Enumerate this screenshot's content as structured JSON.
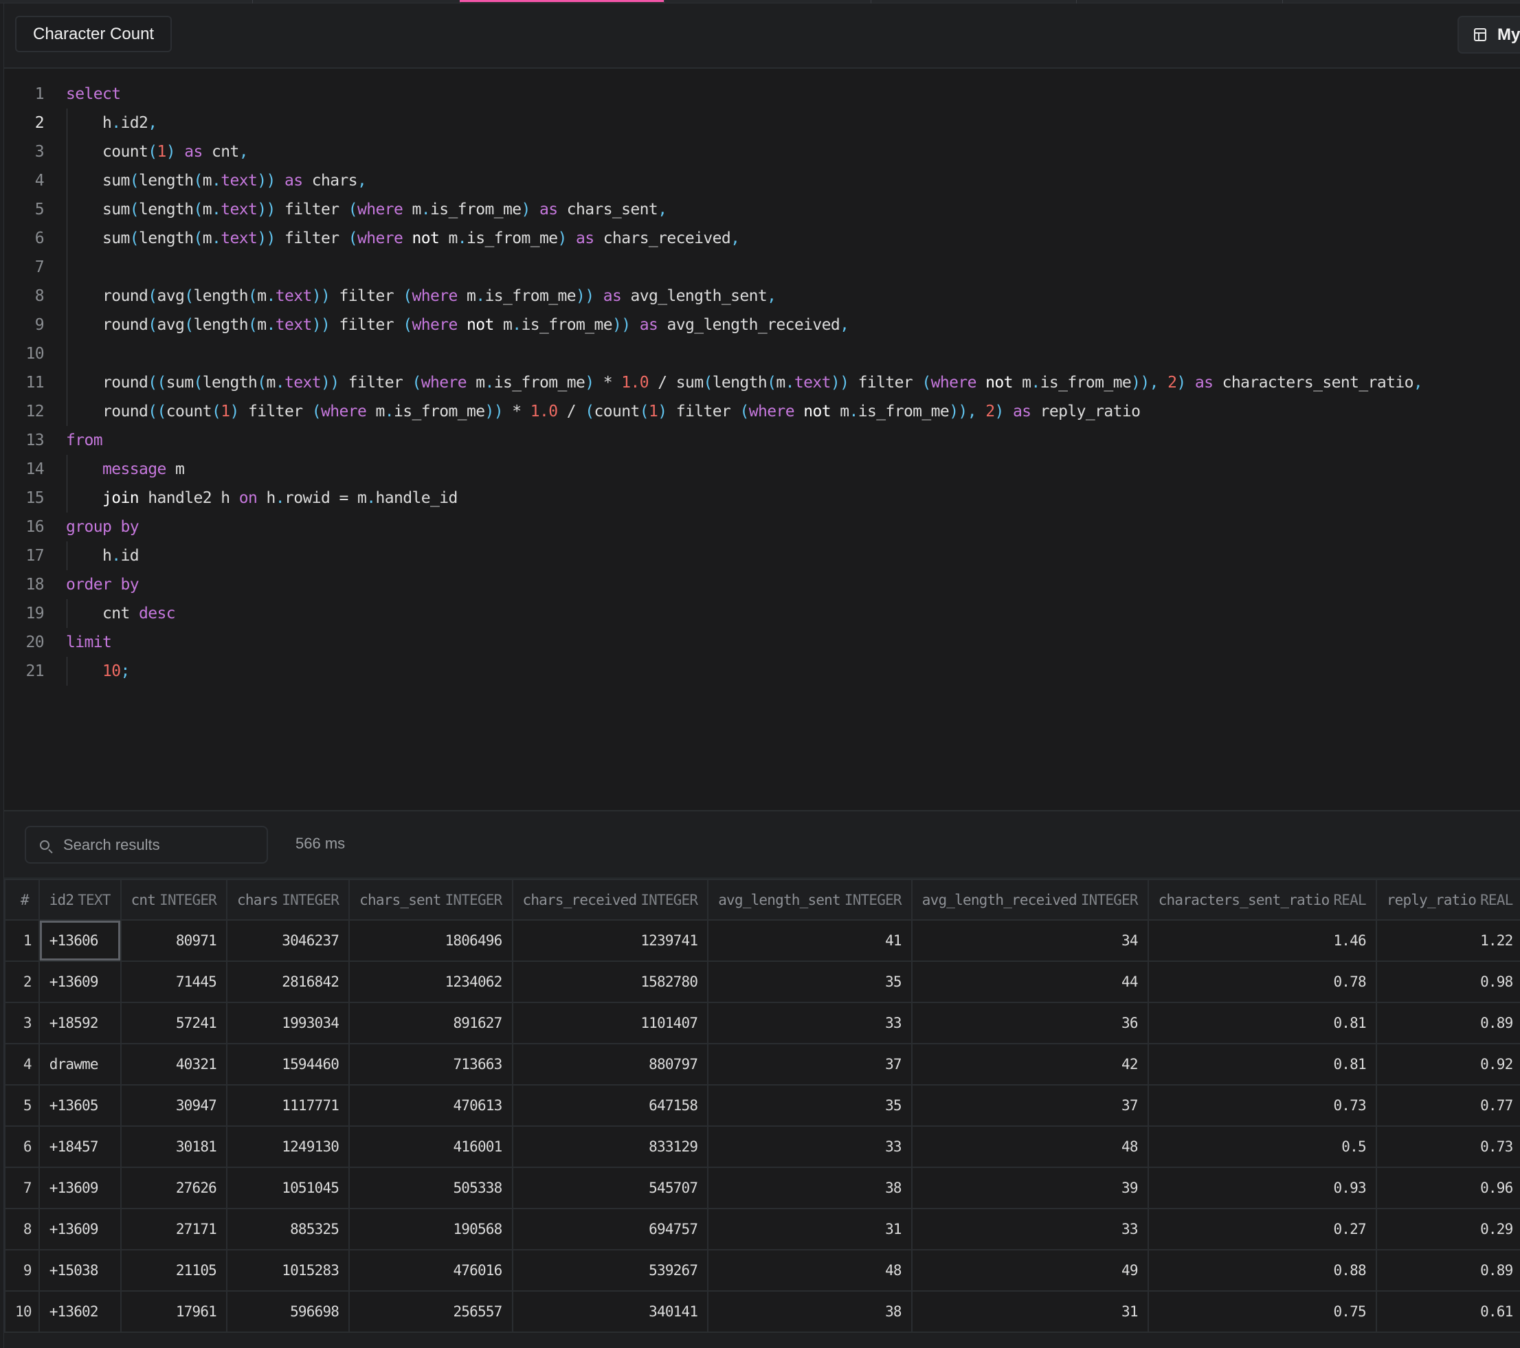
{
  "tabstrip": {
    "separators": 7,
    "active_color": "#f255a8"
  },
  "toolbar": {
    "title": "Character Count",
    "view_button_label": "My",
    "view_button_icon": "layout-icon"
  },
  "editor": {
    "active_line": 2,
    "lines": [
      {
        "num": "1",
        "indent": false,
        "tokens": [
          [
            "k",
            "select"
          ]
        ]
      },
      {
        "num": "2",
        "indent": true,
        "tokens": [
          [
            "t",
            "h"
          ],
          [
            "p",
            "."
          ],
          [
            "t",
            "id2"
          ],
          [
            "p",
            ","
          ]
        ]
      },
      {
        "num": "3",
        "indent": true,
        "tokens": [
          [
            "t",
            "count"
          ],
          [
            "p",
            "("
          ],
          [
            "n",
            "1"
          ],
          [
            "p",
            ")"
          ],
          [
            "t",
            " "
          ],
          [
            "k",
            "as"
          ],
          [
            "t",
            " cnt"
          ],
          [
            "p",
            ","
          ]
        ]
      },
      {
        "num": "4",
        "indent": true,
        "tokens": [
          [
            "t",
            "sum"
          ],
          [
            "p",
            "("
          ],
          [
            "t",
            "length"
          ],
          [
            "p",
            "("
          ],
          [
            "t",
            "m"
          ],
          [
            "p",
            "."
          ],
          [
            "k",
            "text"
          ],
          [
            "p",
            "))"
          ],
          [
            "t",
            " "
          ],
          [
            "k",
            "as"
          ],
          [
            "t",
            " chars"
          ],
          [
            "p",
            ","
          ]
        ]
      },
      {
        "num": "5",
        "indent": true,
        "tokens": [
          [
            "t",
            "sum"
          ],
          [
            "p",
            "("
          ],
          [
            "t",
            "length"
          ],
          [
            "p",
            "("
          ],
          [
            "t",
            "m"
          ],
          [
            "p",
            "."
          ],
          [
            "k",
            "text"
          ],
          [
            "p",
            "))"
          ],
          [
            "t",
            " filter "
          ],
          [
            "p",
            "("
          ],
          [
            "k",
            "where"
          ],
          [
            "t",
            " m"
          ],
          [
            "p",
            "."
          ],
          [
            "t",
            "is_from_me"
          ],
          [
            "p",
            ")"
          ],
          [
            "t",
            " "
          ],
          [
            "k",
            "as"
          ],
          [
            "t",
            " chars_sent"
          ],
          [
            "p",
            ","
          ]
        ]
      },
      {
        "num": "6",
        "indent": true,
        "tokens": [
          [
            "t",
            "sum"
          ],
          [
            "p",
            "("
          ],
          [
            "t",
            "length"
          ],
          [
            "p",
            "("
          ],
          [
            "t",
            "m"
          ],
          [
            "p",
            "."
          ],
          [
            "k",
            "text"
          ],
          [
            "p",
            "))"
          ],
          [
            "t",
            " filter "
          ],
          [
            "p",
            "("
          ],
          [
            "k",
            "where"
          ],
          [
            "w",
            " not"
          ],
          [
            "t",
            " m"
          ],
          [
            "p",
            "."
          ],
          [
            "t",
            "is_from_me"
          ],
          [
            "p",
            ")"
          ],
          [
            "t",
            " "
          ],
          [
            "k",
            "as"
          ],
          [
            "t",
            " chars_received"
          ],
          [
            "p",
            ","
          ]
        ]
      },
      {
        "num": "7",
        "indent": true,
        "tokens": []
      },
      {
        "num": "8",
        "indent": true,
        "tokens": [
          [
            "t",
            "round"
          ],
          [
            "p",
            "("
          ],
          [
            "t",
            "avg"
          ],
          [
            "p",
            "("
          ],
          [
            "t",
            "length"
          ],
          [
            "p",
            "("
          ],
          [
            "t",
            "m"
          ],
          [
            "p",
            "."
          ],
          [
            "k",
            "text"
          ],
          [
            "p",
            "))"
          ],
          [
            "t",
            " filter "
          ],
          [
            "p",
            "("
          ],
          [
            "k",
            "where"
          ],
          [
            "t",
            " m"
          ],
          [
            "p",
            "."
          ],
          [
            "t",
            "is_from_me"
          ],
          [
            "p",
            "))"
          ],
          [
            "t",
            " "
          ],
          [
            "k",
            "as"
          ],
          [
            "t",
            " avg_length_sent"
          ],
          [
            "p",
            ","
          ]
        ]
      },
      {
        "num": "9",
        "indent": true,
        "tokens": [
          [
            "t",
            "round"
          ],
          [
            "p",
            "("
          ],
          [
            "t",
            "avg"
          ],
          [
            "p",
            "("
          ],
          [
            "t",
            "length"
          ],
          [
            "p",
            "("
          ],
          [
            "t",
            "m"
          ],
          [
            "p",
            "."
          ],
          [
            "k",
            "text"
          ],
          [
            "p",
            "))"
          ],
          [
            "t",
            " filter "
          ],
          [
            "p",
            "("
          ],
          [
            "k",
            "where"
          ],
          [
            "w",
            " not"
          ],
          [
            "t",
            " m"
          ],
          [
            "p",
            "."
          ],
          [
            "t",
            "is_from_me"
          ],
          [
            "p",
            "))"
          ],
          [
            "t",
            " "
          ],
          [
            "k",
            "as"
          ],
          [
            "t",
            " avg_length_received"
          ],
          [
            "p",
            ","
          ]
        ]
      },
      {
        "num": "10",
        "indent": true,
        "tokens": []
      },
      {
        "num": "11",
        "indent": true,
        "tokens": [
          [
            "t",
            "round"
          ],
          [
            "p",
            "(("
          ],
          [
            "t",
            "sum"
          ],
          [
            "p",
            "("
          ],
          [
            "t",
            "length"
          ],
          [
            "p",
            "("
          ],
          [
            "t",
            "m"
          ],
          [
            "p",
            "."
          ],
          [
            "k",
            "text"
          ],
          [
            "p",
            "))"
          ],
          [
            "t",
            " filter "
          ],
          [
            "p",
            "("
          ],
          [
            "k",
            "where"
          ],
          [
            "t",
            " m"
          ],
          [
            "p",
            "."
          ],
          [
            "t",
            "is_from_me"
          ],
          [
            "p",
            ")"
          ],
          [
            "t",
            " * "
          ],
          [
            "n",
            "1.0"
          ],
          [
            "t",
            " / sum"
          ],
          [
            "p",
            "("
          ],
          [
            "t",
            "length"
          ],
          [
            "p",
            "("
          ],
          [
            "t",
            "m"
          ],
          [
            "p",
            "."
          ],
          [
            "k",
            "text"
          ],
          [
            "p",
            "))"
          ],
          [
            "t",
            " filter "
          ],
          [
            "p",
            "("
          ],
          [
            "k",
            "where"
          ],
          [
            "w",
            " not"
          ],
          [
            "t",
            " m"
          ],
          [
            "p",
            "."
          ],
          [
            "t",
            "is_from_me"
          ],
          [
            "p",
            "))"
          ],
          [
            "p",
            ","
          ],
          [
            "t",
            " "
          ],
          [
            "n",
            "2"
          ],
          [
            "p",
            ")"
          ],
          [
            "t",
            " "
          ],
          [
            "k",
            "as"
          ],
          [
            "t",
            " characters_sent_ratio"
          ],
          [
            "p",
            ","
          ]
        ]
      },
      {
        "num": "12",
        "indent": true,
        "tokens": [
          [
            "t",
            "round"
          ],
          [
            "p",
            "(("
          ],
          [
            "t",
            "count"
          ],
          [
            "p",
            "("
          ],
          [
            "n",
            "1"
          ],
          [
            "p",
            ")"
          ],
          [
            "t",
            " filter "
          ],
          [
            "p",
            "("
          ],
          [
            "k",
            "where"
          ],
          [
            "t",
            " m"
          ],
          [
            "p",
            "."
          ],
          [
            "t",
            "is_from_me"
          ],
          [
            "p",
            "))"
          ],
          [
            "t",
            " * "
          ],
          [
            "n",
            "1.0"
          ],
          [
            "t",
            " / "
          ],
          [
            "p",
            "("
          ],
          [
            "t",
            "count"
          ],
          [
            "p",
            "("
          ],
          [
            "n",
            "1"
          ],
          [
            "p",
            ")"
          ],
          [
            "t",
            " filter "
          ],
          [
            "p",
            "("
          ],
          [
            "k",
            "where"
          ],
          [
            "w",
            " not"
          ],
          [
            "t",
            " m"
          ],
          [
            "p",
            "."
          ],
          [
            "t",
            "is_from_me"
          ],
          [
            "p",
            "))"
          ],
          [
            "p",
            ","
          ],
          [
            "t",
            " "
          ],
          [
            "n",
            "2"
          ],
          [
            "p",
            ")"
          ],
          [
            "t",
            " "
          ],
          [
            "k",
            "as"
          ],
          [
            "t",
            " reply_ratio"
          ]
        ]
      },
      {
        "num": "13",
        "indent": false,
        "tokens": [
          [
            "k",
            "from"
          ]
        ]
      },
      {
        "num": "14",
        "indent": true,
        "tokens": [
          [
            "k",
            "message"
          ],
          [
            "t",
            " m"
          ]
        ]
      },
      {
        "num": "15",
        "indent": true,
        "tokens": [
          [
            "w",
            "join"
          ],
          [
            "t",
            " handle2 h "
          ],
          [
            "k",
            "on"
          ],
          [
            "t",
            " h"
          ],
          [
            "p",
            "."
          ],
          [
            "t",
            "rowid = m"
          ],
          [
            "p",
            "."
          ],
          [
            "t",
            "handle_id"
          ]
        ]
      },
      {
        "num": "16",
        "indent": false,
        "tokens": [
          [
            "k",
            "group by"
          ]
        ]
      },
      {
        "num": "17",
        "indent": true,
        "tokens": [
          [
            "t",
            "h"
          ],
          [
            "p",
            "."
          ],
          [
            "t",
            "id"
          ]
        ]
      },
      {
        "num": "18",
        "indent": false,
        "tokens": [
          [
            "k",
            "order by"
          ]
        ]
      },
      {
        "num": "19",
        "indent": true,
        "tokens": [
          [
            "t",
            "cnt "
          ],
          [
            "k",
            "desc"
          ]
        ]
      },
      {
        "num": "20",
        "indent": false,
        "tokens": [
          [
            "k",
            "limit"
          ]
        ]
      },
      {
        "num": "21",
        "indent": true,
        "tokens": [
          [
            "n",
            "10"
          ],
          [
            "p",
            ";"
          ]
        ]
      }
    ]
  },
  "results": {
    "search_placeholder": "Search results",
    "search_value": "",
    "timing": "566 ms",
    "columns": [
      {
        "name": "#",
        "type": ""
      },
      {
        "name": "id2",
        "type": "TEXT"
      },
      {
        "name": "cnt",
        "type": "INTEGER"
      },
      {
        "name": "chars",
        "type": "INTEGER"
      },
      {
        "name": "chars_sent",
        "type": "INTEGER"
      },
      {
        "name": "chars_received",
        "type": "INTEGER"
      },
      {
        "name": "avg_length_sent",
        "type": "INTEGER"
      },
      {
        "name": "avg_length_received",
        "type": "INTEGER"
      },
      {
        "name": "characters_sent_ratio",
        "type": "REAL"
      },
      {
        "name": "reply_ratio",
        "type": "REAL"
      }
    ],
    "selected_cell": {
      "row": 1,
      "column": "id2"
    },
    "rows": [
      [
        "1",
        "+13606",
        "80971",
        "3046237",
        "1806496",
        "1239741",
        "41",
        "34",
        "1.46",
        "1.22"
      ],
      [
        "2",
        "+13609",
        "71445",
        "2816842",
        "1234062",
        "1582780",
        "35",
        "44",
        "0.78",
        "0.98"
      ],
      [
        "3",
        "+18592",
        "57241",
        "1993034",
        "891627",
        "1101407",
        "33",
        "36",
        "0.81",
        "0.89"
      ],
      [
        "4",
        "drawme",
        "40321",
        "1594460",
        "713663",
        "880797",
        "37",
        "42",
        "0.81",
        "0.92"
      ],
      [
        "5",
        "+13605",
        "30947",
        "1117771",
        "470613",
        "647158",
        "35",
        "37",
        "0.73",
        "0.77"
      ],
      [
        "6",
        "+18457",
        "30181",
        "1249130",
        "416001",
        "833129",
        "33",
        "48",
        "0.5",
        "0.73"
      ],
      [
        "7",
        "+13609",
        "27626",
        "1051045",
        "505338",
        "545707",
        "38",
        "39",
        "0.93",
        "0.96"
      ],
      [
        "8",
        "+13609",
        "27171",
        "885325",
        "190568",
        "694757",
        "31",
        "33",
        "0.27",
        "0.29"
      ],
      [
        "9",
        "+15038",
        "21105",
        "1015283",
        "476016",
        "539267",
        "48",
        "49",
        "0.88",
        "0.89"
      ],
      [
        "10",
        "+13602",
        "17961",
        "596698",
        "256557",
        "340141",
        "38",
        "31",
        "0.75",
        "0.61"
      ]
    ]
  }
}
